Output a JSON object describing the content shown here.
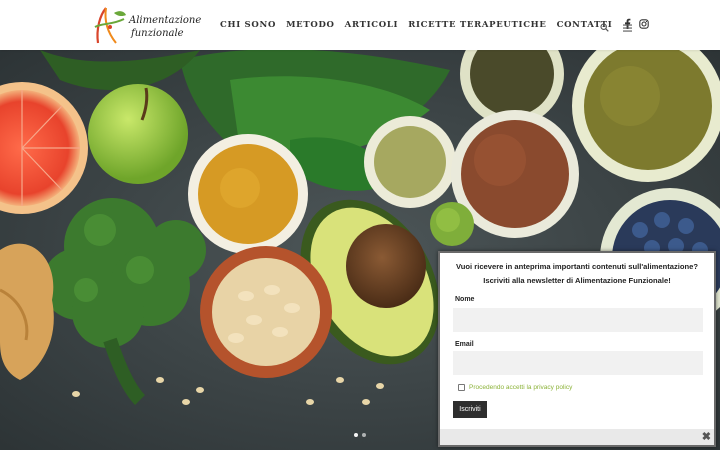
{
  "header": {
    "logo_line1": "Alimentazione",
    "logo_line2": "funzionale",
    "nav": [
      {
        "label": "CHI SONO"
      },
      {
        "label": "METODO"
      },
      {
        "label": "ARTICOLI"
      },
      {
        "label": "RICETTE TERAPEUTICHE"
      },
      {
        "label": "CONTATTI"
      }
    ],
    "social": [
      "facebook-icon",
      "instagram-icon"
    ],
    "tools": [
      "search-icon",
      "menu-icon"
    ]
  },
  "hero": {
    "description": "healthy food flat-lay"
  },
  "popup": {
    "title_line1": "Vuoi ricevere in anteprima importanti contenuti sull'alimentazione?",
    "title_line2": "Iscriviti alla newsletter di Alimentazione Funzionale!",
    "name_label": "Nome",
    "name_value": "",
    "email_label": "Email",
    "email_value": "",
    "privacy_label": "Procedendo accetti la privacy policy",
    "submit_label": "Iscriviti",
    "close_label": "✖"
  },
  "colors": {
    "accent_green": "#8cb33a",
    "logo_red": "#d9452b",
    "logo_orange": "#f08a1c",
    "logo_green": "#6aa83a",
    "dark_button": "#2e2e2e"
  }
}
